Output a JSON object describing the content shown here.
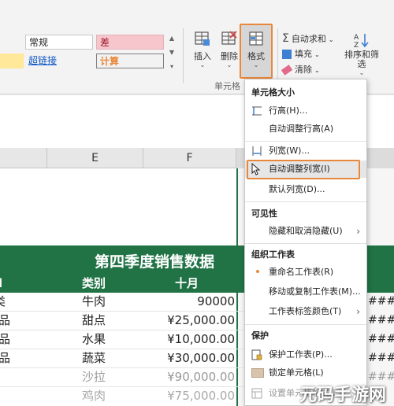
{
  "ribbon": {
    "styles": {
      "normal": "常规",
      "bad": "差",
      "hyperlink": "超链接",
      "calculation": "计算"
    },
    "cells_group": {
      "insert": "插入",
      "delete": "删除",
      "format": "格式",
      "group_label": "单元格"
    },
    "editing": {
      "autosum": "自动求和",
      "fill": "填充",
      "clear": "清除",
      "sort_filter": "排序和筛选"
    }
  },
  "columns": [
    "E",
    "F"
  ],
  "sheet": {
    "title": "第四季度销售数据",
    "headers": {
      "category": "类别",
      "month": "十月"
    },
    "row_stubs": [
      "l",
      "类",
      "品",
      "品",
      "品",
      "!",
      "!"
    ],
    "rows": [
      {
        "category": "牛肉",
        "value": "90000"
      },
      {
        "category": "甜点",
        "value": "¥25,000.00"
      },
      {
        "category": "水果",
        "value": "¥10,000.00"
      },
      {
        "category": "蔬菜",
        "value": "¥30,000.00"
      },
      {
        "category": "沙拉",
        "value": "¥90,000.00"
      },
      {
        "category": "鸡肉",
        "value": "¥75,000.00"
      }
    ],
    "overflow_hashes": [
      "###",
      "###",
      "###",
      "###",
      "###"
    ]
  },
  "menu": {
    "section_cell_size": "单元格大小",
    "row_height": "行高(H)...",
    "autofit_row_height": "自动调整行高(A)",
    "column_width": "列宽(W)...",
    "autofit_column_width": "自动调整列宽(I)",
    "default_width": "默认列宽(D)...",
    "section_visibility": "可见性",
    "hide_unhide": "隐藏和取消隐藏(U)",
    "section_organize": "组织工作表",
    "rename_sheet": "重命名工作表(R)",
    "move_copy_sheet": "移动或复制工作表(M)...",
    "tab_color": "工作表标签颜色(T)",
    "section_protection": "保护",
    "protect_sheet": "保护工作表(P)...",
    "lock_cell": "锁定单元格(L)",
    "format_cells": "设置单元格格式(E)..."
  },
  "watermark": "元码手游网",
  "colors": {
    "accent_green": "#217346",
    "highlight_orange": "#e8883a",
    "bad_style_bg": "#f7c6cd",
    "calc_orange": "#e8883a"
  }
}
